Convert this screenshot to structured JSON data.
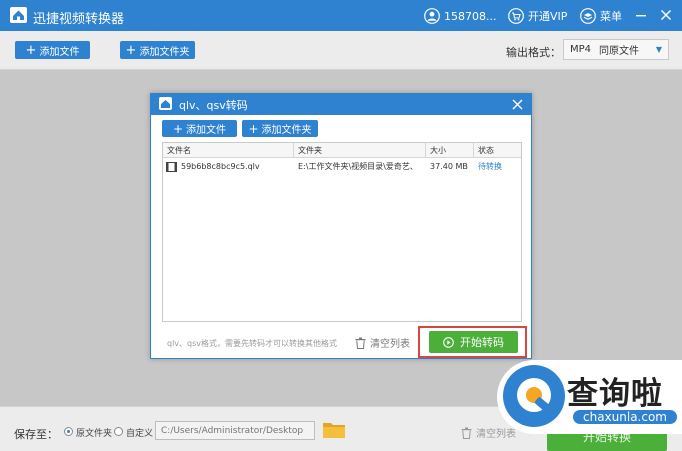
{
  "app": {
    "title": "迅捷视频转换器",
    "user_id": "158708...",
    "vip_label": "开通VIP",
    "menu_label": "菜单"
  },
  "toolbar": {
    "add_file_label": "添加文件",
    "add_folder_label": "添加文件夹",
    "output_format_label": "输出格式：",
    "output_format_value": "MP4",
    "output_format_quality": "同原文件"
  },
  "dialog": {
    "title": "qlv、qsv转码",
    "add_file_label": "添加文件",
    "add_folder_label": "添加文件夹",
    "columns": [
      "文件名",
      "文件夹",
      "大小",
      "状态"
    ],
    "rows": [
      {
        "name": "59b6b8c8bc9c5.qlv",
        "folder": "E:\\工作文件夹\\视频目录\\爱奇艺、",
        "size": "37.40 MB",
        "status": "待转换"
      }
    ],
    "note": "qlv、qsv格式，需要先转码才可以转换其他格式",
    "clear_label": "清空列表",
    "start_label": "开始转码"
  },
  "bottom": {
    "save_to_label": "保存至：",
    "option_source": "原文件夹",
    "option_custom": "自定义",
    "path_placeholder": "C:/Users/Administrator/Desktop",
    "clear_label": "清空列表",
    "start_label": "开始转换"
  },
  "watermark": {
    "text": "查询啦",
    "domain": "chaxunla.com"
  },
  "colors": {
    "brand_blue": "#2f82d0",
    "start_green": "#4caf3a",
    "highlight_red": "#d9463f",
    "accent_orange": "#f5a623"
  },
  "icons": {
    "app_logo": "house-logo-icon",
    "user": "user-icon",
    "vip": "cart-icon",
    "menu": "layers-icon",
    "minimize": "minimize-icon",
    "close": "close-icon",
    "folder": "folder-icon",
    "trash": "trash-icon",
    "play": "play-circle-icon",
    "file": "video-file-icon"
  }
}
